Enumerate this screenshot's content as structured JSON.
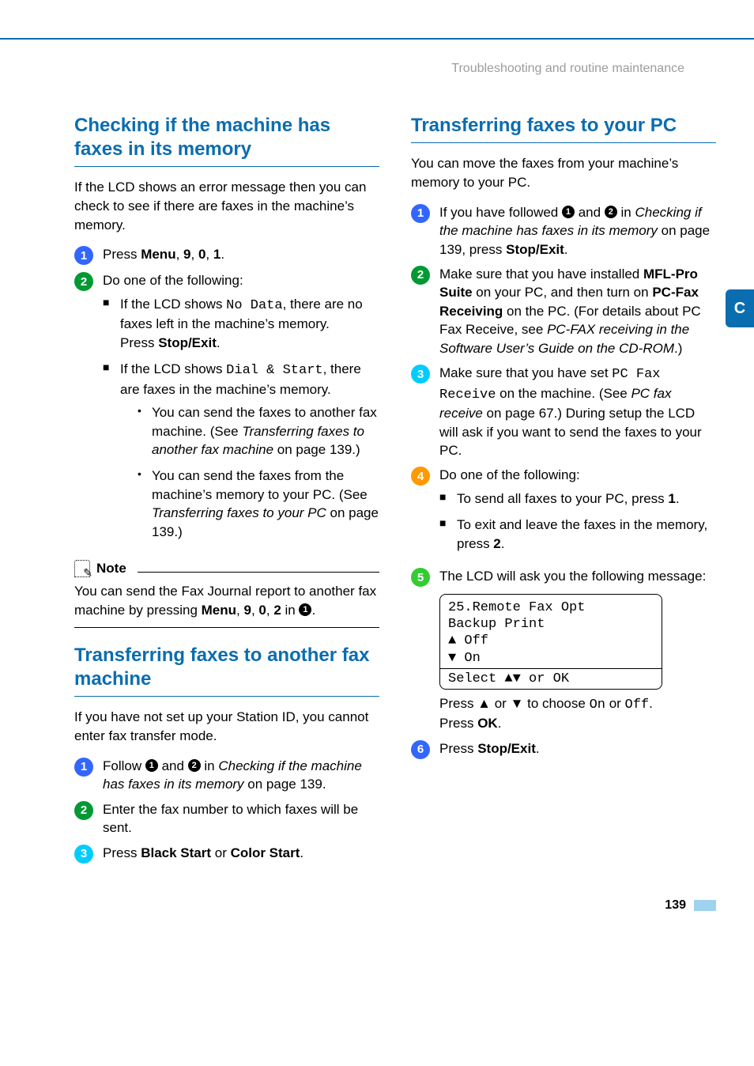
{
  "running_header": "Troubleshooting and routine maintenance",
  "side_tab": "C",
  "page_number": "139",
  "left": {
    "section1": {
      "heading": "Checking if the machine has faxes in its memory",
      "intro": "If the LCD shows an error message then you can check to see if there are faxes in the machine’s memory.",
      "step1_a": "Press ",
      "step1_b_bold": "Menu",
      "step1_c": ", ",
      "step1_d_bold": "9",
      "step1_e": ", ",
      "step1_f_bold": "0",
      "step1_g": ", ",
      "step1_h_bold": "1",
      "step1_i": ".",
      "step2_intro": "Do one of the following:",
      "step2_li1_a": "If the LCD shows ",
      "step2_li1_mono": "No Data",
      "step2_li1_b": ", there are no faxes left in the machine’s memory.",
      "step2_li1_c": "Press ",
      "step2_li1_d_bold": "Stop/Exit",
      "step2_li1_e": ".",
      "step2_li2_a": "If the LCD shows ",
      "step2_li2_mono": "Dial & Start",
      "step2_li2_b": ", there are faxes in the machine’s memory.",
      "step2_sub1_a": "You can send the faxes to another fax machine. (See ",
      "step2_sub1_it": "Transferring faxes to another fax machine",
      "step2_sub1_b": " on page 139.)",
      "step2_sub2_a": "You can send the faxes from the machine’s memory to your PC. (See ",
      "step2_sub2_it": "Transferring faxes to your PC",
      "step2_sub2_b": " on page 139.)",
      "note_label": "Note",
      "note_body_a": "You can send the Fax Journal report to another fax machine by pressing ",
      "note_body_b_bold": "Menu",
      "note_body_c": ", ",
      "note_body_d_bold": "9",
      "note_body_e": ", ",
      "note_body_f_bold": "0",
      "note_body_g": ", ",
      "note_body_h_bold": "2",
      "note_body_i": " in ",
      "note_body_ref": "1",
      "note_body_j": "."
    },
    "section2": {
      "heading": "Transferring faxes to another fax machine",
      "intro": "If you have not set up your Station ID, you cannot enter fax transfer mode.",
      "step1_a": "Follow ",
      "step1_ref1": "1",
      "step1_b": " and ",
      "step1_ref2": "2",
      "step1_c": " in ",
      "step1_it": "Checking if the machine has faxes in its memory",
      "step1_d": " on page 139.",
      "step2": "Enter the fax number to which faxes will be sent.",
      "step3_a": "Press ",
      "step3_b_bold": "Black Start",
      "step3_c": " or ",
      "step3_d_bold": "Color Start",
      "step3_e": "."
    }
  },
  "right": {
    "section": {
      "heading": "Transferring faxes to your PC",
      "intro": "You can move the faxes from your machine’s memory to your PC.",
      "step1_a": "If you have followed ",
      "step1_ref1": "1",
      "step1_b": " and ",
      "step1_ref2": "2",
      "step1_c": " in ",
      "step1_it": "Checking if the machine has faxes in its memory",
      "step1_d": " on page 139, press ",
      "step1_e_bold": "Stop/Exit",
      "step1_f": ".",
      "step2_a": "Make sure that you have installed ",
      "step2_b_bold": "MFL-Pro Suite",
      "step2_c": " on your PC, and then turn on ",
      "step2_d_bold": "PC-Fax Receiving",
      "step2_e": " on the PC. (For details about PC Fax Receive, see ",
      "step2_f_it": "PC-FAX receiving in the Software User’s Guide on the CD-ROM",
      "step2_g": ".)",
      "step3_a": "Make sure that you have set ",
      "step3_mono": "PC Fax Receive",
      "step3_b": " on the machine. (See ",
      "step3_c_it": "PC fax receive",
      "step3_d": " on page 67.) During setup the LCD will ask if you want to send the faxes to your PC.",
      "step4_intro": "Do one of the following:",
      "step4_li1_a": "To send all faxes to your PC, press ",
      "step4_li1_b_bold": "1",
      "step4_li1_c": ".",
      "step4_li2_a": "To exit and leave the faxes in the memory, press ",
      "step4_li2_b_bold": "2",
      "step4_li2_c": ".",
      "step5_intro": "The LCD will ask you the following message:",
      "lcd_line1": "25.Remote Fax Opt",
      "lcd_line2": "  Backup Print",
      "lcd_line3_arrow_up": "▲",
      "lcd_line3_text": "    Off",
      "lcd_line4_arrow_down": "▼",
      "lcd_line4_text": "    On",
      "lcd_line5_a": "Select ",
      "lcd_line5_b": "▲▼",
      "lcd_line5_c": " or OK",
      "after_lcd_a": "Press ▲ or ▼ to choose ",
      "after_lcd_mono1": "On",
      "after_lcd_b": " or ",
      "after_lcd_mono2": "Off",
      "after_lcd_c": ".",
      "after_lcd_d": "Press ",
      "after_lcd_e_bold": "OK",
      "after_lcd_f": ".",
      "step6_a": "Press ",
      "step6_b_bold": "Stop/Exit",
      "step6_c": "."
    }
  }
}
